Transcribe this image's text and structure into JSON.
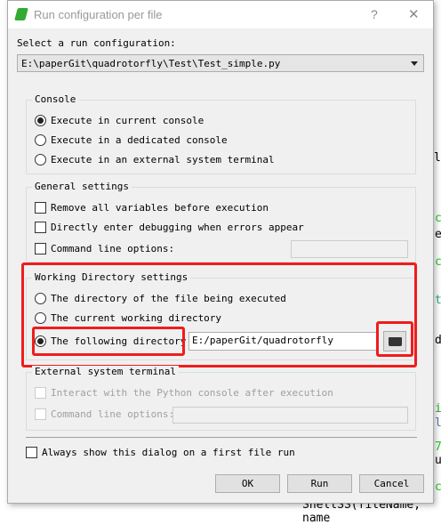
{
  "dialog": {
    "title": "Run configuration per file",
    "help_label": "?",
    "close_label": "✕",
    "select_label": "Select a run configuration:",
    "selected_config": "E:\\paperGit\\quadrotorfly\\Test\\Test_simple.py"
  },
  "console": {
    "title": "Console",
    "options": [
      {
        "label": "Execute in current console",
        "selected": true
      },
      {
        "label": "Execute in a dedicated console",
        "selected": false
      },
      {
        "label": "Execute in an external system terminal",
        "selected": false
      }
    ]
  },
  "general": {
    "title": "General settings",
    "remove_vars": "Remove all variables before execution",
    "debug": "Directly enter debugging when errors appear",
    "cmd_options": "Command line options:",
    "cmd_value": ""
  },
  "workdir": {
    "title": "Working Directory settings",
    "opt_file_dir": "The directory of the file being executed",
    "opt_cwd": "The current working directory",
    "opt_following": "The following directory",
    "path": "E:/paperGit/quadrotorfly",
    "highlight_color": "#f01c1c"
  },
  "external": {
    "title": "External system terminal",
    "interact": "Interact with the Python console after execution",
    "cmd_options": "Command line options:"
  },
  "always_show": "Always show this dialog on a first file run",
  "buttons": {
    "ok": "OK",
    "run": "Run",
    "cancel": "Cancel"
  }
}
